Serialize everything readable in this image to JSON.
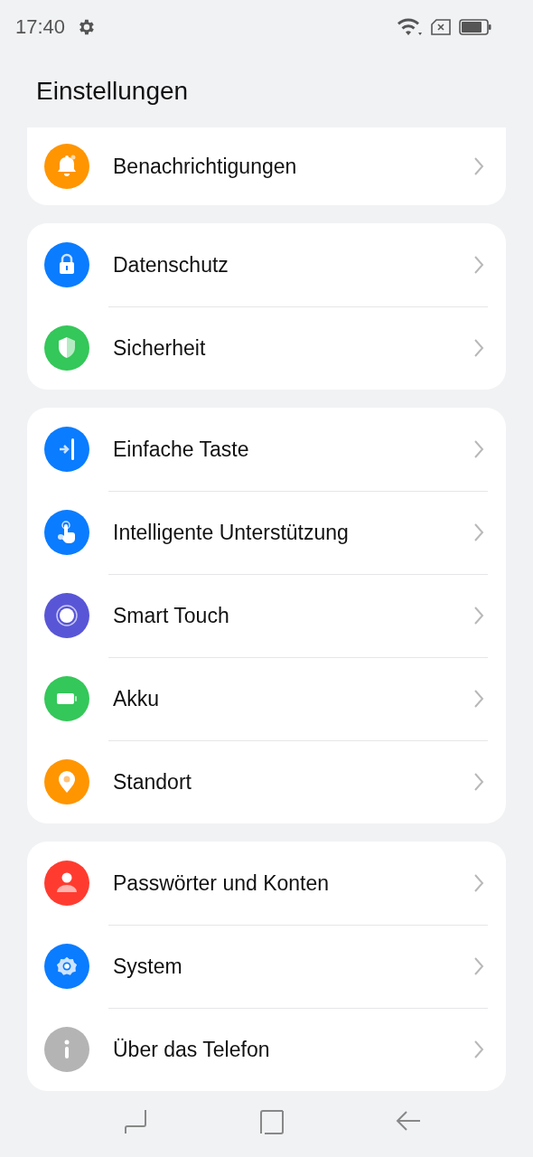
{
  "status_bar": {
    "time": "17:40"
  },
  "title": "Einstellungen",
  "groups": [
    {
      "items": [
        {
          "label": "Benachrichtigungen",
          "kind": "bell",
          "color": "#ff9500"
        }
      ]
    },
    {
      "items": [
        {
          "label": "Datenschutz",
          "kind": "lock",
          "color": "#0a7cff"
        },
        {
          "label": "Sicherheit",
          "kind": "shield",
          "color": "#34c759"
        }
      ]
    },
    {
      "items": [
        {
          "label": "Einfache Taste",
          "kind": "sidekey",
          "color": "#0a7cff"
        },
        {
          "label": "Intelligente Unterstützung",
          "kind": "touch",
          "color": "#0a7cff"
        },
        {
          "label": "Smart Touch",
          "kind": "ring",
          "color": "#5856d6"
        },
        {
          "label": "Akku",
          "kind": "battery",
          "color": "#34c759"
        },
        {
          "label": "Standort",
          "kind": "pin",
          "color": "#ff9500"
        }
      ]
    },
    {
      "items": [
        {
          "label": "Passwörter und Konten",
          "kind": "person",
          "color": "#ff3b30"
        },
        {
          "label": "System",
          "kind": "gear",
          "color": "#0a7cff"
        },
        {
          "label": "Über das Telefon",
          "kind": "info",
          "color": "#b4b4b4"
        }
      ]
    }
  ]
}
